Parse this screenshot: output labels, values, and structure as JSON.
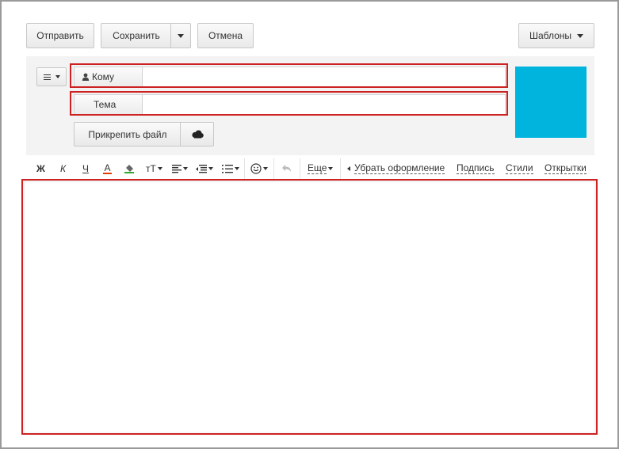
{
  "toolbar": {
    "send_label": "Отправить",
    "save_label": "Сохранить",
    "cancel_label": "Отмена",
    "templates_label": "Шаблоны"
  },
  "compose": {
    "to_label": "Кому",
    "subject_label": "Тема",
    "to_value": "",
    "subject_value": "",
    "attach_label": "Прикрепить файл"
  },
  "format": {
    "bold": "Ж",
    "italic": "К",
    "underline": "Ч",
    "font_color": "А",
    "font_size": "тТ",
    "more": "Еще",
    "remove_formatting": "Убрать оформление",
    "signature": "Подпись",
    "styles": "Стили",
    "cards": "Открытки"
  },
  "editor": {
    "body": ""
  },
  "colors": {
    "avatar": "#00b4de",
    "highlight_border": "#cc2222",
    "compose_bg": "#f3f3f3",
    "font_color_underline": "#e03c00",
    "marker_green": "#2fa82f"
  },
  "icons": {
    "to_icon": "person-icon",
    "attach_cloud": "cloud-icon",
    "menu": "hamburger-icon",
    "emoji": "smiley-icon",
    "undo": "undo-icon"
  }
}
